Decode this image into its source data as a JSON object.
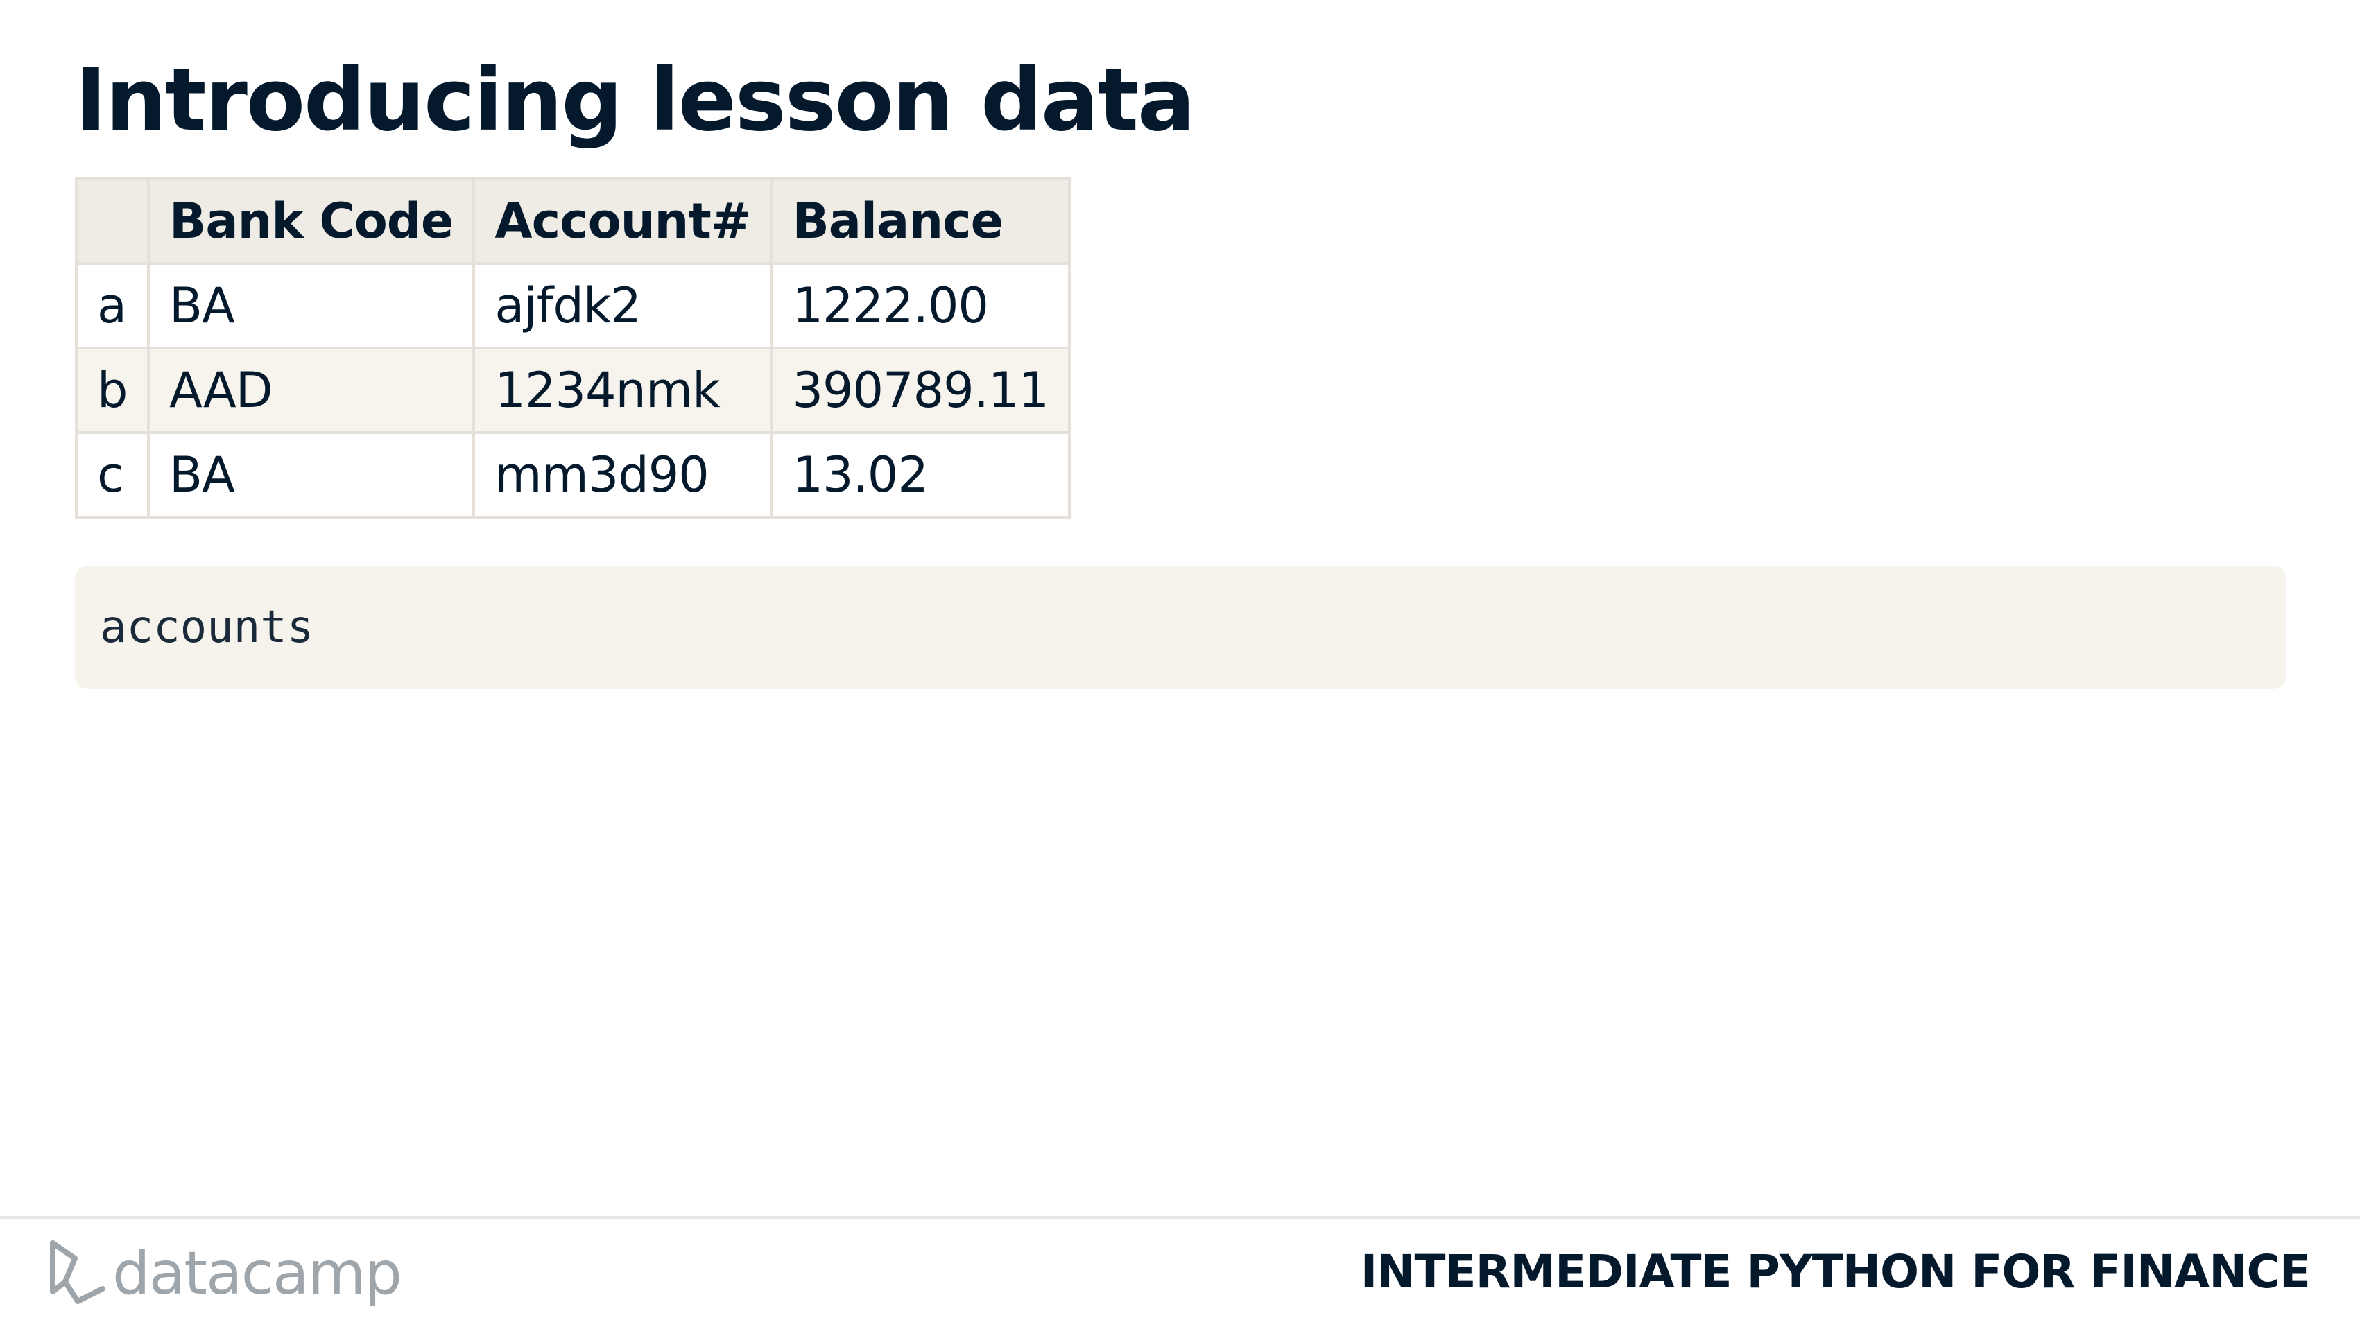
{
  "slide": {
    "title": "Introducing lesson data"
  },
  "table": {
    "headers": [
      "",
      "Bank Code",
      "Account#",
      "Balance"
    ],
    "rows": [
      {
        "index": "a",
        "bank_code": "BA",
        "account": "ajfdk2",
        "balance": "1222.00"
      },
      {
        "index": "b",
        "bank_code": "AAD",
        "account": "1234nmk",
        "balance": "390789.11"
      },
      {
        "index": "c",
        "bank_code": "BA",
        "account": "mm3d90",
        "balance": "13.02"
      }
    ]
  },
  "code": {
    "text": "accounts"
  },
  "footer": {
    "brand": "datacamp",
    "course_title": "INTERMEDIATE PYTHON FOR FINANCE",
    "logo_icon": "datacamp-logo-icon"
  },
  "colors": {
    "text": "#05192d",
    "header_bg": "#efebe5",
    "stripe_bg": "#f7f4ee",
    "code_bg": "#f6f3ec",
    "border": "#e5e1da",
    "logo_gray": "#9ea5ab"
  }
}
